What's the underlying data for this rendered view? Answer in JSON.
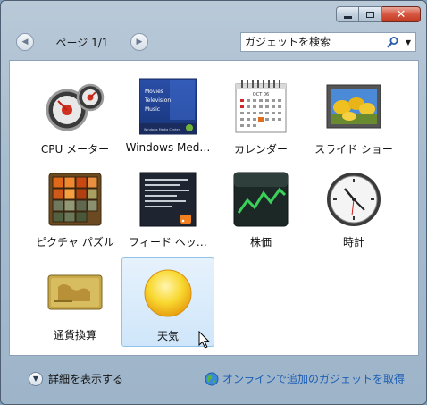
{
  "window": {
    "title": "",
    "close_symbol": "✕"
  },
  "pager": {
    "label": "ページ 1/1"
  },
  "search": {
    "placeholder": "ガジェットを検索"
  },
  "gadgets": [
    {
      "label": "CPU メーター",
      "icon": "cpu-meter-icon",
      "selected": false
    },
    {
      "label": "Windows Med…",
      "icon": "media-center-icon",
      "selected": false
    },
    {
      "label": "カレンダー",
      "icon": "calendar-icon",
      "selected": false
    },
    {
      "label": "スライド ショー",
      "icon": "slideshow-icon",
      "selected": false
    },
    {
      "label": "ピクチャ パズル",
      "icon": "picture-puzzle-icon",
      "selected": false
    },
    {
      "label": "フィード ヘッ…",
      "icon": "feed-headlines-icon",
      "selected": false
    },
    {
      "label": "株価",
      "icon": "stocks-icon",
      "selected": false
    },
    {
      "label": "時計",
      "icon": "clock-icon",
      "selected": false
    },
    {
      "label": "通貨換算",
      "icon": "currency-icon",
      "selected": false
    },
    {
      "label": "天気",
      "icon": "weather-icon",
      "selected": true
    }
  ],
  "media_center_lines": [
    "Movies",
    "Television",
    "Music"
  ],
  "media_center_badge": "Windows Media Center",
  "calendar_month": "OCT 06",
  "footer": {
    "details_label": "詳細を表示する",
    "online_link": "オンラインで追加のガジェットを取得"
  },
  "colors": {
    "accent_link": "#1f5fb4",
    "selection_border": "#8fc3ea",
    "close_button": "#c13a22"
  }
}
